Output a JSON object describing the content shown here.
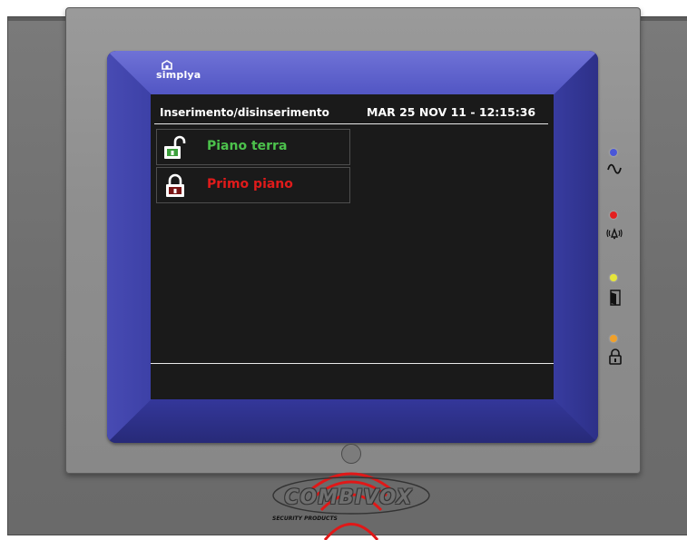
{
  "device": {
    "brand_name": "simplya",
    "maker_name": "COMBIVOX",
    "maker_tagline": "SECURITY PRODUCTS"
  },
  "screen": {
    "title": "Inserimento/disinserimento",
    "datetime": "MAR 25 NOV 11 - 12:15:36"
  },
  "areas": [
    {
      "label": "Piano terra",
      "state": "unlocked",
      "icon": "open-padlock-icon",
      "color": "#4cc24c"
    },
    {
      "label": "Primo piano",
      "state": "locked",
      "icon": "closed-padlock-icon",
      "color": "#e01b1b"
    }
  ],
  "indicators": [
    {
      "name": "power",
      "led_color": "#4a57d8",
      "icon": "sine-wave-icon"
    },
    {
      "name": "alarm",
      "led_color": "#e32020",
      "icon": "alarm-bell-icon"
    },
    {
      "name": "door",
      "led_color": "#e6e63a",
      "icon": "door-icon"
    },
    {
      "name": "armed",
      "led_color": "#f0a02a",
      "icon": "padlock-icon"
    }
  ],
  "colors": {
    "frame_blue": "#3b3f9b",
    "screen_bg": "#1a1a1a",
    "text_white": "#ffffff",
    "logo_red": "#e01818"
  }
}
